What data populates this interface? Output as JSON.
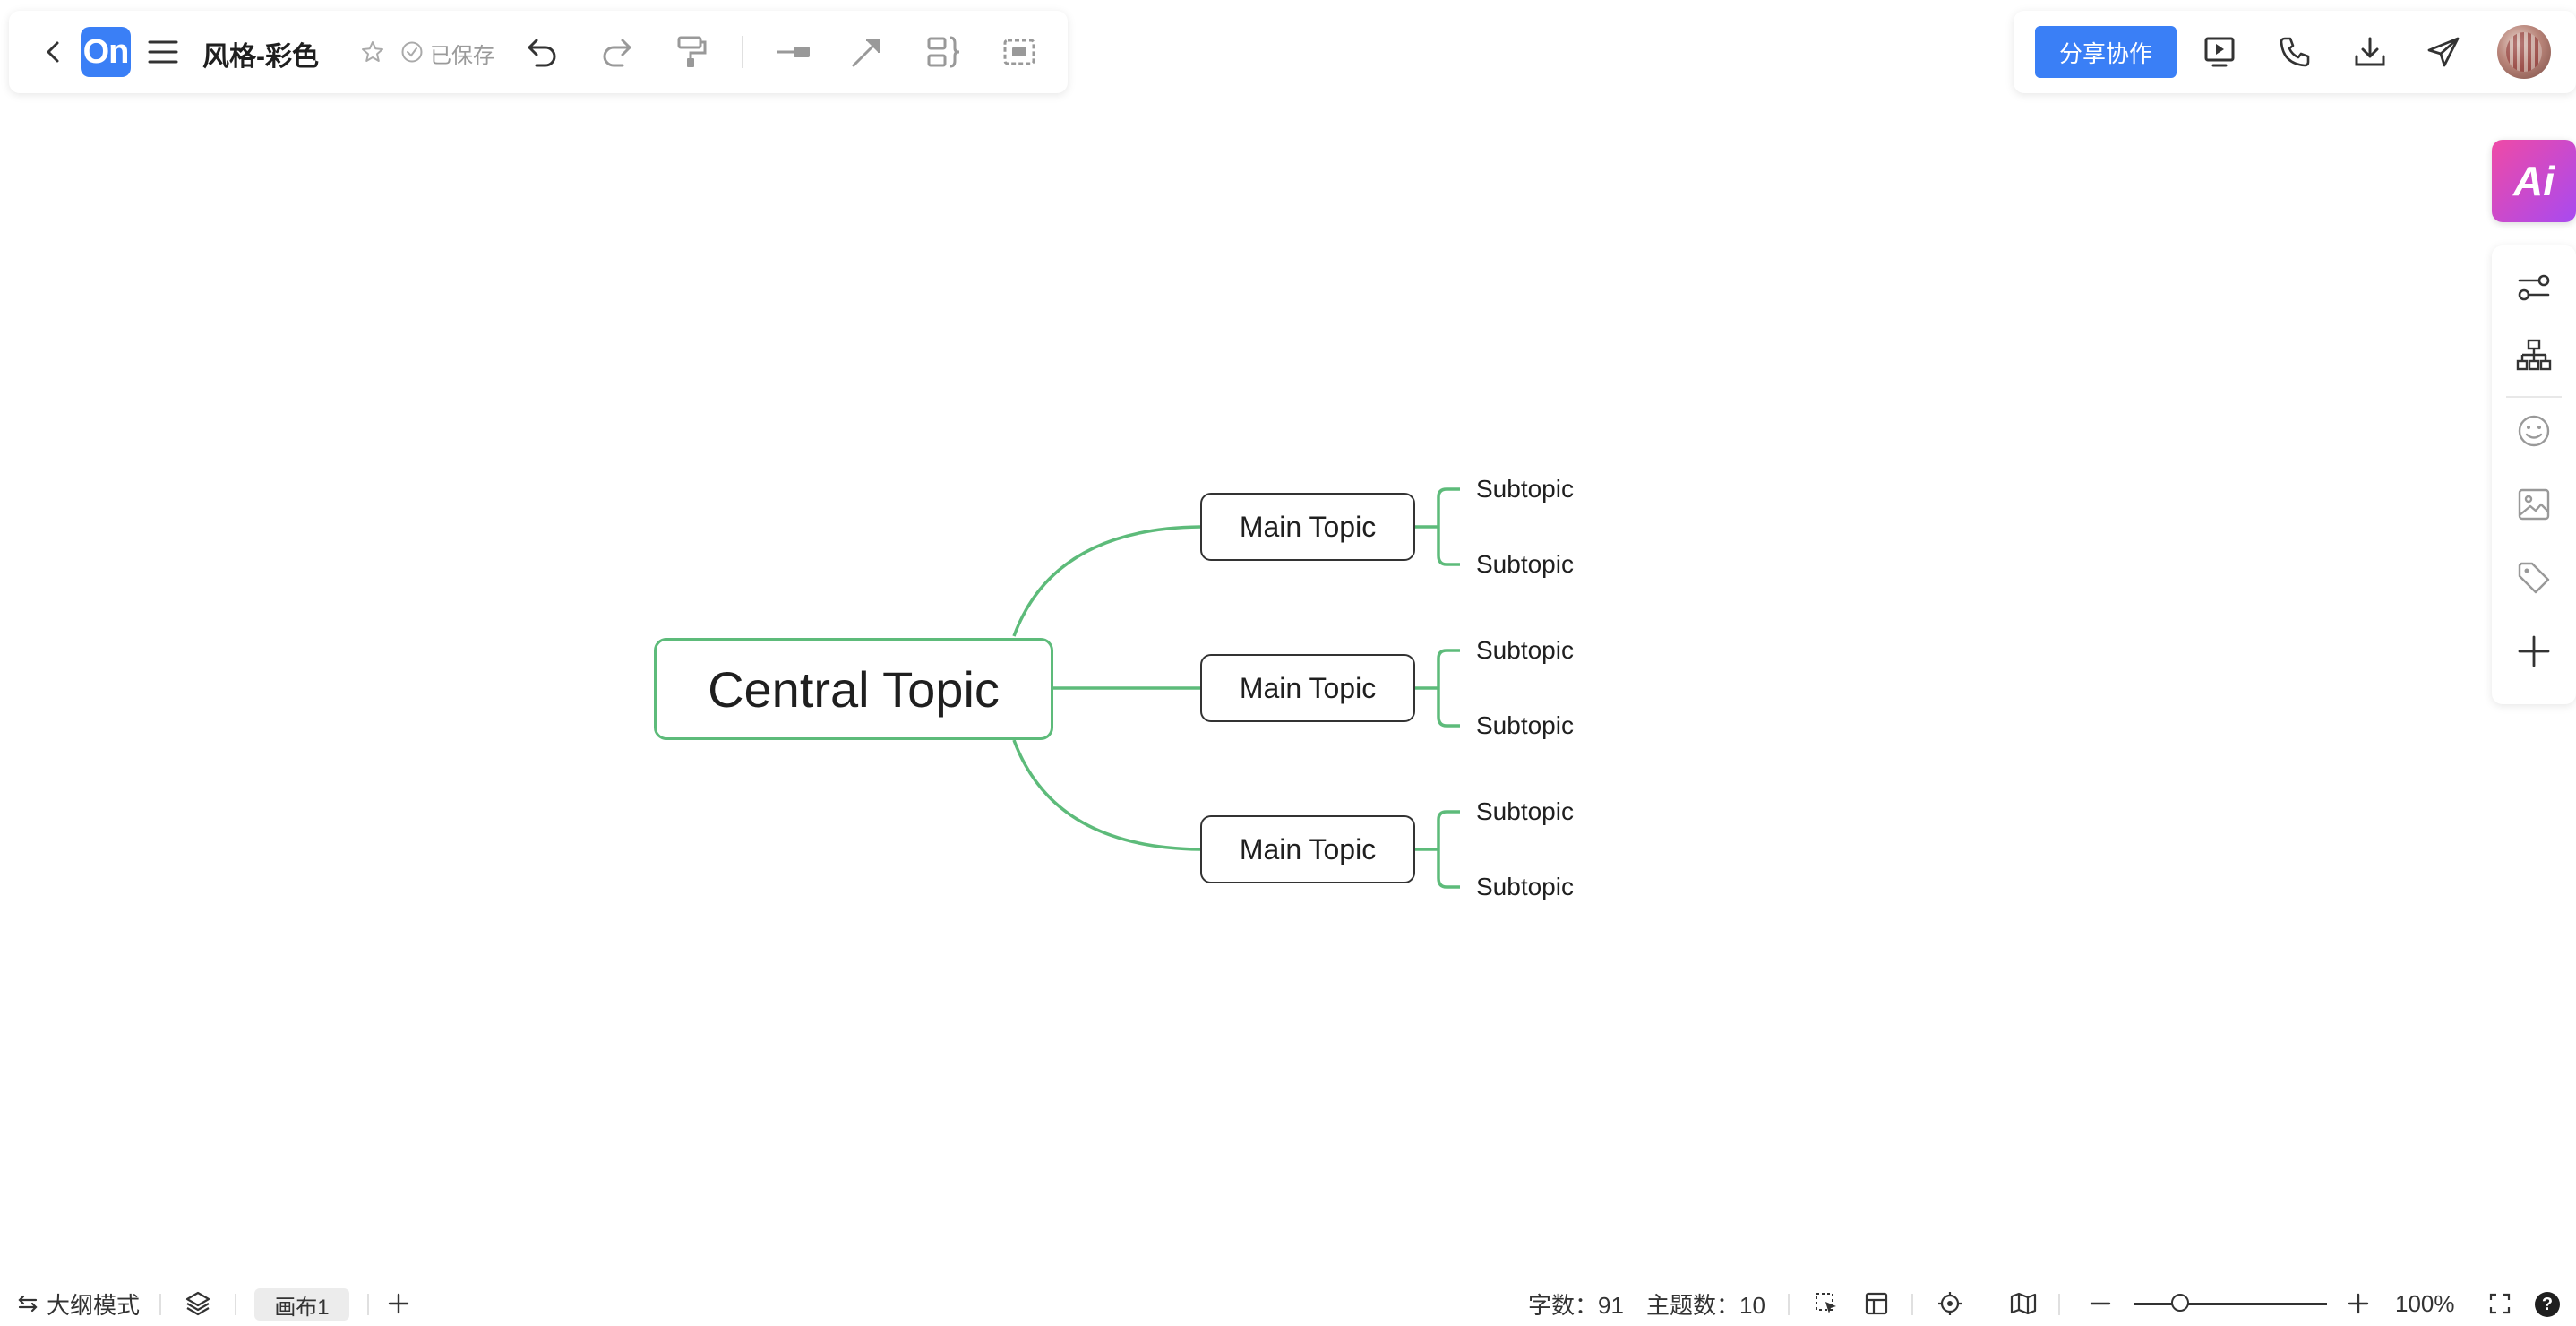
{
  "app": {
    "logo_text": "On",
    "document_title": "风格-彩色",
    "saved_status": "已保存",
    "share_button_label": "分享协作",
    "accent_color": "#3a7ff6"
  },
  "toolbar_left": {
    "icons": [
      "back-chevron-icon",
      "logo",
      "menu-icon",
      "star-icon",
      "saved-check-icon",
      "undo-icon",
      "redo-icon",
      "format-painter-icon",
      "connector-line-icon",
      "arrow-line-icon",
      "summary-bracket-icon",
      "boundary-frame-icon"
    ]
  },
  "toolbar_right": {
    "icons": [
      "presentation-icon",
      "phone-call-icon",
      "download-icon",
      "send-icon",
      "avatar"
    ]
  },
  "ai_panel": {
    "label": "Ai"
  },
  "side_tools": [
    "settings-sliders-icon",
    "structure-tree-icon",
    "emoji-icon",
    "image-icon",
    "tag-icon",
    "plus-icon"
  ],
  "mindmap": {
    "central_topic": "Central Topic",
    "line_color": "#5dbb7a",
    "main_topics": [
      {
        "label": "Main Topic",
        "subtopics": [
          "Subtopic",
          "Subtopic"
        ]
      },
      {
        "label": "Main Topic",
        "subtopics": [
          "Subtopic",
          "Subtopic"
        ]
      },
      {
        "label": "Main Topic",
        "subtopics": [
          "Subtopic",
          "Subtopic"
        ]
      }
    ]
  },
  "statusbar": {
    "outline_mode_label": "大纲模式",
    "canvas_tab_label": "画布1",
    "word_count_label": "字数：91",
    "topic_count_label": "主题数：10",
    "zoom_level": "100%",
    "zoom_fraction": 0.24,
    "help_label": "?"
  }
}
